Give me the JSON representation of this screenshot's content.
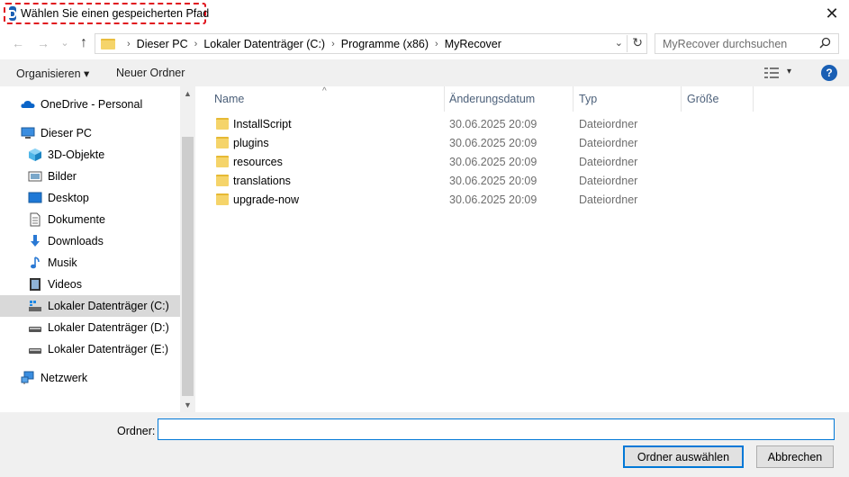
{
  "window": {
    "title": "Wählen Sie einen gespeicherten Pfad",
    "close_glyph": "✕"
  },
  "nav": {
    "back_glyph": "←",
    "forward_glyph": "→",
    "recent_glyph": "⌄",
    "up_glyph": "↑",
    "breadcrumbs": [
      "Dieser PC",
      "Lokaler Datenträger (C:)",
      "Programme (x86)",
      "MyRecover"
    ],
    "separator": "›",
    "dropdown_glyph": "⌄",
    "refresh_glyph": "↻",
    "search_placeholder": "MyRecover durchsuchen"
  },
  "toolbar": {
    "organize_label": "Organisieren ▾",
    "new_folder_label": "Neuer Ordner",
    "view_dropdown_glyph": "▾",
    "help_label": "?"
  },
  "sidebar": {
    "items": [
      {
        "label": "OneDrive - Personal",
        "icon": "cloud-icon"
      },
      {
        "label": "Dieser PC",
        "icon": "computer-icon"
      },
      {
        "label": "3D-Objekte",
        "icon": "cube-icon"
      },
      {
        "label": "Bilder",
        "icon": "pictures-icon"
      },
      {
        "label": "Desktop",
        "icon": "desktop-icon"
      },
      {
        "label": "Dokumente",
        "icon": "document-icon"
      },
      {
        "label": "Downloads",
        "icon": "download-icon"
      },
      {
        "label": "Musik",
        "icon": "music-icon"
      },
      {
        "label": "Videos",
        "icon": "video-icon"
      },
      {
        "label": "Lokaler Datenträger (C:)",
        "icon": "drive-icon",
        "selected": true
      },
      {
        "label": "Lokaler Datenträger (D:)",
        "icon": "drive-icon"
      },
      {
        "label": "Lokaler Datenträger (E:)",
        "icon": "drive-icon"
      },
      {
        "label": "Netzwerk",
        "icon": "network-icon"
      }
    ],
    "scroll_up_glyph": "▲",
    "scroll_down_glyph": "▼"
  },
  "files": {
    "columns": [
      "Name",
      "Änderungsdatum",
      "Typ",
      "Größe"
    ],
    "sort_glyph": "^",
    "rows": [
      {
        "name": "InstallScript",
        "date": "30.06.2025 20:09",
        "type": "Dateiordner"
      },
      {
        "name": "plugins",
        "date": "30.06.2025 20:09",
        "type": "Dateiordner"
      },
      {
        "name": "resources",
        "date": "30.06.2025 20:09",
        "type": "Dateiordner"
      },
      {
        "name": "translations",
        "date": "30.06.2025 20:09",
        "type": "Dateiordner"
      },
      {
        "name": "upgrade-now",
        "date": "30.06.2025 20:09",
        "type": "Dateiordner"
      }
    ]
  },
  "footer": {
    "folder_label": "Ordner:",
    "folder_value": "",
    "select_button": "Ordner auswählen",
    "cancel_button": "Abbrechen"
  },
  "colors": {
    "accent": "#0078d7",
    "title_highlight": "#e0141e",
    "folder": "#f5d46a",
    "selection": "#d9d9d9"
  }
}
